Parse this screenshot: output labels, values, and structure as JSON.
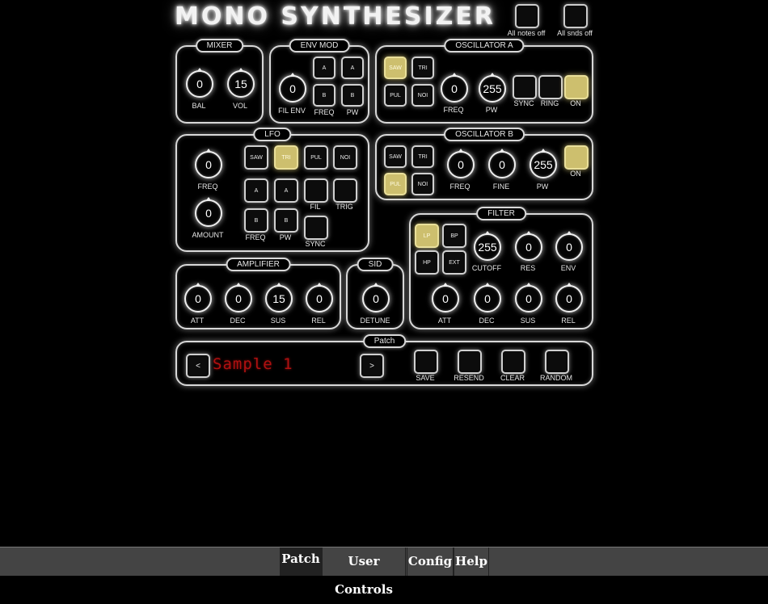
{
  "app": {
    "title": "MONO SYNTHESIZER"
  },
  "top_buttons": {
    "all_notes_off": "All notes off",
    "all_snds_off": "All snds off"
  },
  "mixer": {
    "title": "MIXER",
    "bal": {
      "label": "BAL",
      "value": "0"
    },
    "vol": {
      "label": "VOL",
      "value": "15"
    }
  },
  "env_mod": {
    "title": "ENV MOD",
    "fil_env": {
      "label": "FIL ENV",
      "value": "0"
    },
    "btn_a": "A",
    "btn_b": "B",
    "freq": "FREQ",
    "pw": "PW"
  },
  "osc_a": {
    "title": "OSCILLATOR A",
    "saw": "SAW",
    "tri": "TRI",
    "pul": "PUL",
    "noi": "NOI",
    "freq": {
      "label": "FREQ",
      "value": "0"
    },
    "pw": {
      "label": "PW",
      "value": "255"
    },
    "sync": "SYNC",
    "ring": "RING",
    "on": "ON"
  },
  "lfo": {
    "title": "LFO",
    "freq": {
      "label": "FREQ",
      "value": "0"
    },
    "amount": {
      "label": "AMOUNT",
      "value": "0"
    },
    "saw": "SAW",
    "tri": "TRI",
    "pul": "PUL",
    "noi": "NOI",
    "btn_a": "A",
    "btn_b": "B",
    "fil": "FIL",
    "trig": "TRIG",
    "freq_lbl": "FREQ",
    "pw_lbl": "PW",
    "sync": "SYNC"
  },
  "osc_b": {
    "title": "OSCILLATOR B",
    "saw": "SAW",
    "tri": "TRI",
    "pul": "PUL",
    "noi": "NOI",
    "freq": {
      "label": "FREQ",
      "value": "0"
    },
    "fine": {
      "label": "FINE",
      "value": "0"
    },
    "pw": {
      "label": "PW",
      "value": "255"
    },
    "on": "ON"
  },
  "filter": {
    "title": "FILTER",
    "lp": "LP",
    "bp": "BP",
    "hp": "HP",
    "ext": "EXT",
    "cutoff": {
      "label": "CUTOFF",
      "value": "255"
    },
    "res": {
      "label": "RES",
      "value": "0"
    },
    "env": {
      "label": "ENV",
      "value": "0"
    },
    "att": {
      "label": "ATT",
      "value": "0"
    },
    "dec": {
      "label": "DEC",
      "value": "0"
    },
    "sus": {
      "label": "SUS",
      "value": "0"
    },
    "rel": {
      "label": "REL",
      "value": "0"
    }
  },
  "amplifier": {
    "title": "AMPLIFIER",
    "att": {
      "label": "ATT",
      "value": "0"
    },
    "dec": {
      "label": "DEC",
      "value": "0"
    },
    "sus": {
      "label": "SUS",
      "value": "15"
    },
    "rel": {
      "label": "REL",
      "value": "0"
    }
  },
  "sid": {
    "title": "SID",
    "detune": {
      "label": "DETUNE",
      "value": "0"
    }
  },
  "patch": {
    "title": "Patch",
    "prev": "<",
    "next": ">",
    "name": "Sample 1",
    "save": "SAVE",
    "resend": "RESEND",
    "clear": "CLEAR",
    "random": "RANDOM"
  },
  "tabs": {
    "patch": "Patch",
    "user_controls": "User Controls",
    "config": "Config",
    "help": "Help"
  },
  "colors": {
    "active_button": "#cdbf6e",
    "patch_text": "#b01010",
    "tabbar": "#444444"
  }
}
